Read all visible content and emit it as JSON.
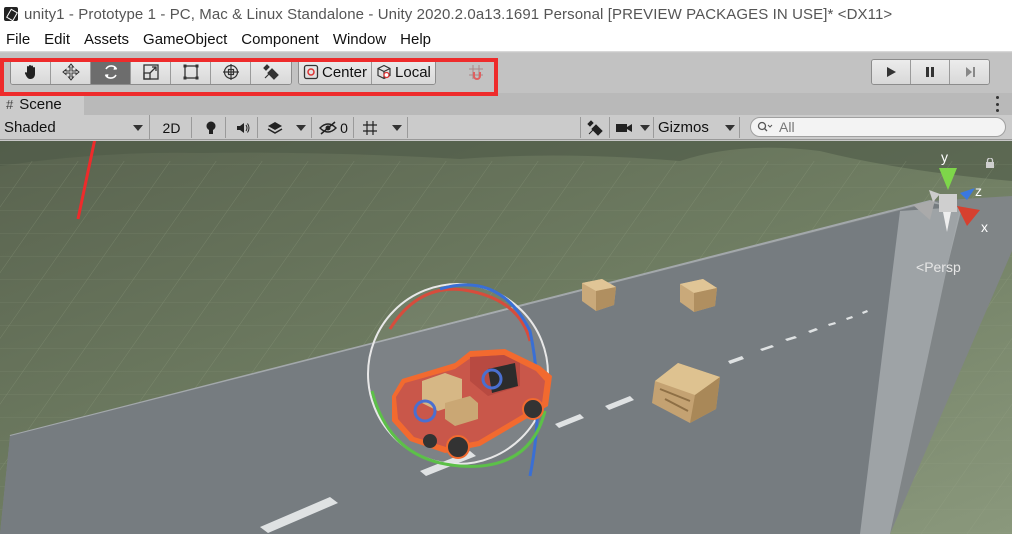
{
  "window": {
    "title": "unity1 - Prototype 1 - PC, Mac & Linux Standalone - Unity 2020.2.0a13.1691 Personal [PREVIEW PACKAGES IN USE]* <DX11>"
  },
  "menu": {
    "items": [
      "File",
      "Edit",
      "Assets",
      "GameObject",
      "Component",
      "Window",
      "Help"
    ]
  },
  "toolbar": {
    "tools": [
      {
        "name": "hand-tool",
        "icon": "hand-icon",
        "active": false
      },
      {
        "name": "move-tool",
        "icon": "move-arrows-icon",
        "active": false
      },
      {
        "name": "rotate-tool",
        "icon": "rotate-icon",
        "active": true
      },
      {
        "name": "scale-tool",
        "icon": "scale-icon",
        "active": false
      },
      {
        "name": "rect-tool",
        "icon": "rect-icon",
        "active": false
      },
      {
        "name": "transform-tool",
        "icon": "transform-icon",
        "active": false
      },
      {
        "name": "custom-tool",
        "icon": "tools-icon",
        "active": false
      }
    ],
    "pivot_label": "Center",
    "rotation_label": "Local",
    "highlight_color": "#ee2b2b"
  },
  "scene": {
    "tab_label": "Scene",
    "shading_mode": "Shaded",
    "mode_2d": "2D",
    "hidden_count": "0",
    "gizmos_label": "Gizmos",
    "search_placeholder": "All",
    "projection_label": "Persp",
    "axis_labels": {
      "x": "x",
      "y": "y",
      "z": "z"
    }
  }
}
